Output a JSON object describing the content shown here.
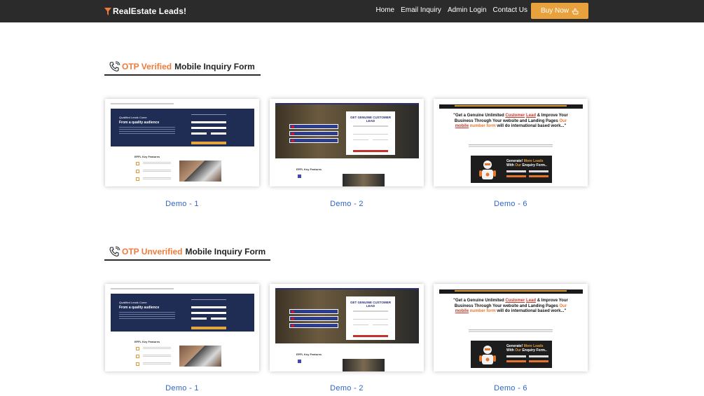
{
  "navbar": {
    "brand": "RealEstate Leads",
    "brand_suffix": "!",
    "links": [
      "Home",
      "Email Inquiry",
      "Admin Login",
      "Contact Us"
    ],
    "buy_label": "Buy Now",
    "colors": {
      "bar": "#2b2b2b",
      "buy": "#e8a23d",
      "accent": "#f07a3b",
      "link_blue": "#2f64c9"
    }
  },
  "sections": [
    {
      "accent": "OTP Verified",
      "rest": "Mobile Inquiry Form",
      "icon": "phone-icon",
      "demos": [
        "Demo - 1",
        "Demo - 2",
        "Demo - 6"
      ]
    },
    {
      "accent": "OTP Unverified",
      "rest": "Mobile Inquiry Form",
      "icon": "phone-icon",
      "demos": [
        "Demo - 1",
        "Demo - 2",
        "Demo - 6"
      ]
    }
  ],
  "preview": {
    "p1_small": "Qualified Leads Come",
    "p1_big": "From a quality audience",
    "p1_features": "EFFL Key Features",
    "p2_title": "GET GENUINE CUSTOMER LEAD",
    "p2_features": "EFFL Key Features",
    "p3_head_1": "\"Get a Genuine Unlimited ",
    "p3_head_customer": "Customer",
    "p3_head_lead": "Lead",
    "p3_head_2": " & Improve Your Business Through Your website and Landing Pages ",
    "p3_head_our": "Our",
    "p3_head_mobile": "mobile",
    "p3_head_numform": "number form",
    "p3_head_3": " will do international based work...\"",
    "p3_gen": "Generate!",
    "p3_more": "More Leads",
    "p3_with": "With",
    "p3_our": "Our",
    "p3_enquiry": "Enquiry Form.."
  }
}
